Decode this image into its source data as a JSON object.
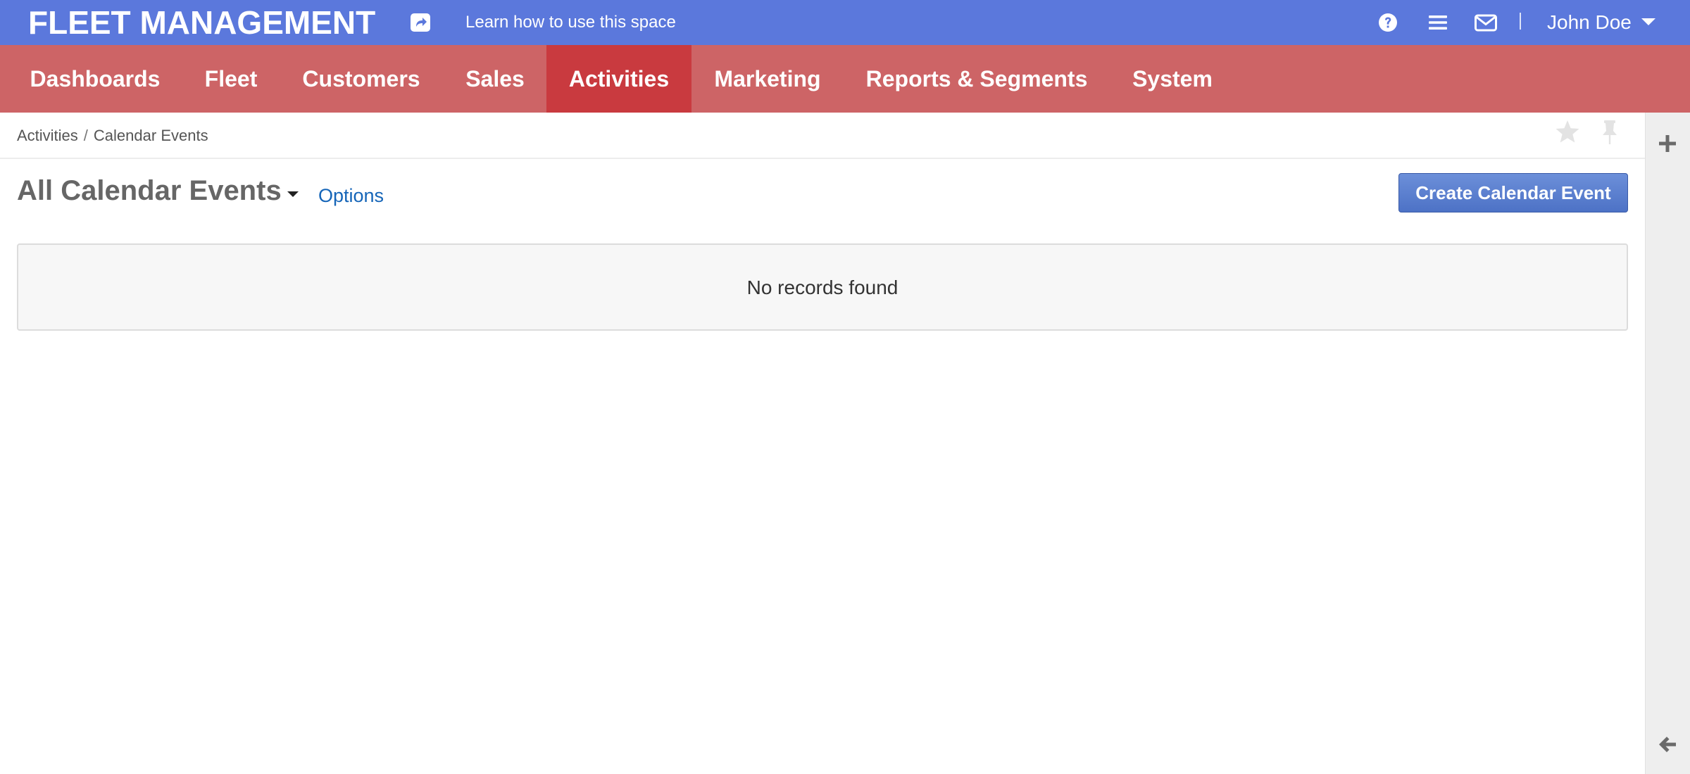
{
  "header": {
    "logo": "FLEET MANAGEMENT",
    "learn_link": "Learn how to use this space",
    "icons": [
      "share-icon",
      "help-icon",
      "menu-icon",
      "mail-icon"
    ],
    "user_name": "John Doe"
  },
  "nav": {
    "items": [
      {
        "label": "Dashboards",
        "active": false
      },
      {
        "label": "Fleet",
        "active": false
      },
      {
        "label": "Customers",
        "active": false
      },
      {
        "label": "Sales",
        "active": false
      },
      {
        "label": "Activities",
        "active": true
      },
      {
        "label": "Marketing",
        "active": false
      },
      {
        "label": "Reports & Segments",
        "active": false
      },
      {
        "label": "System",
        "active": false
      }
    ]
  },
  "breadcrumb": {
    "items": [
      "Activities",
      "Calendar Events"
    ],
    "separator": "/"
  },
  "page": {
    "title": "All Calendar Events",
    "options_label": "Options",
    "create_button": "Create Calendar Event",
    "empty_message": "No records found"
  },
  "colors": {
    "topbar": "#5b78dc",
    "nav": "#cd6466",
    "nav_active": "#c93a3f",
    "primary_button": "#5879cc",
    "link": "#1565b8"
  }
}
